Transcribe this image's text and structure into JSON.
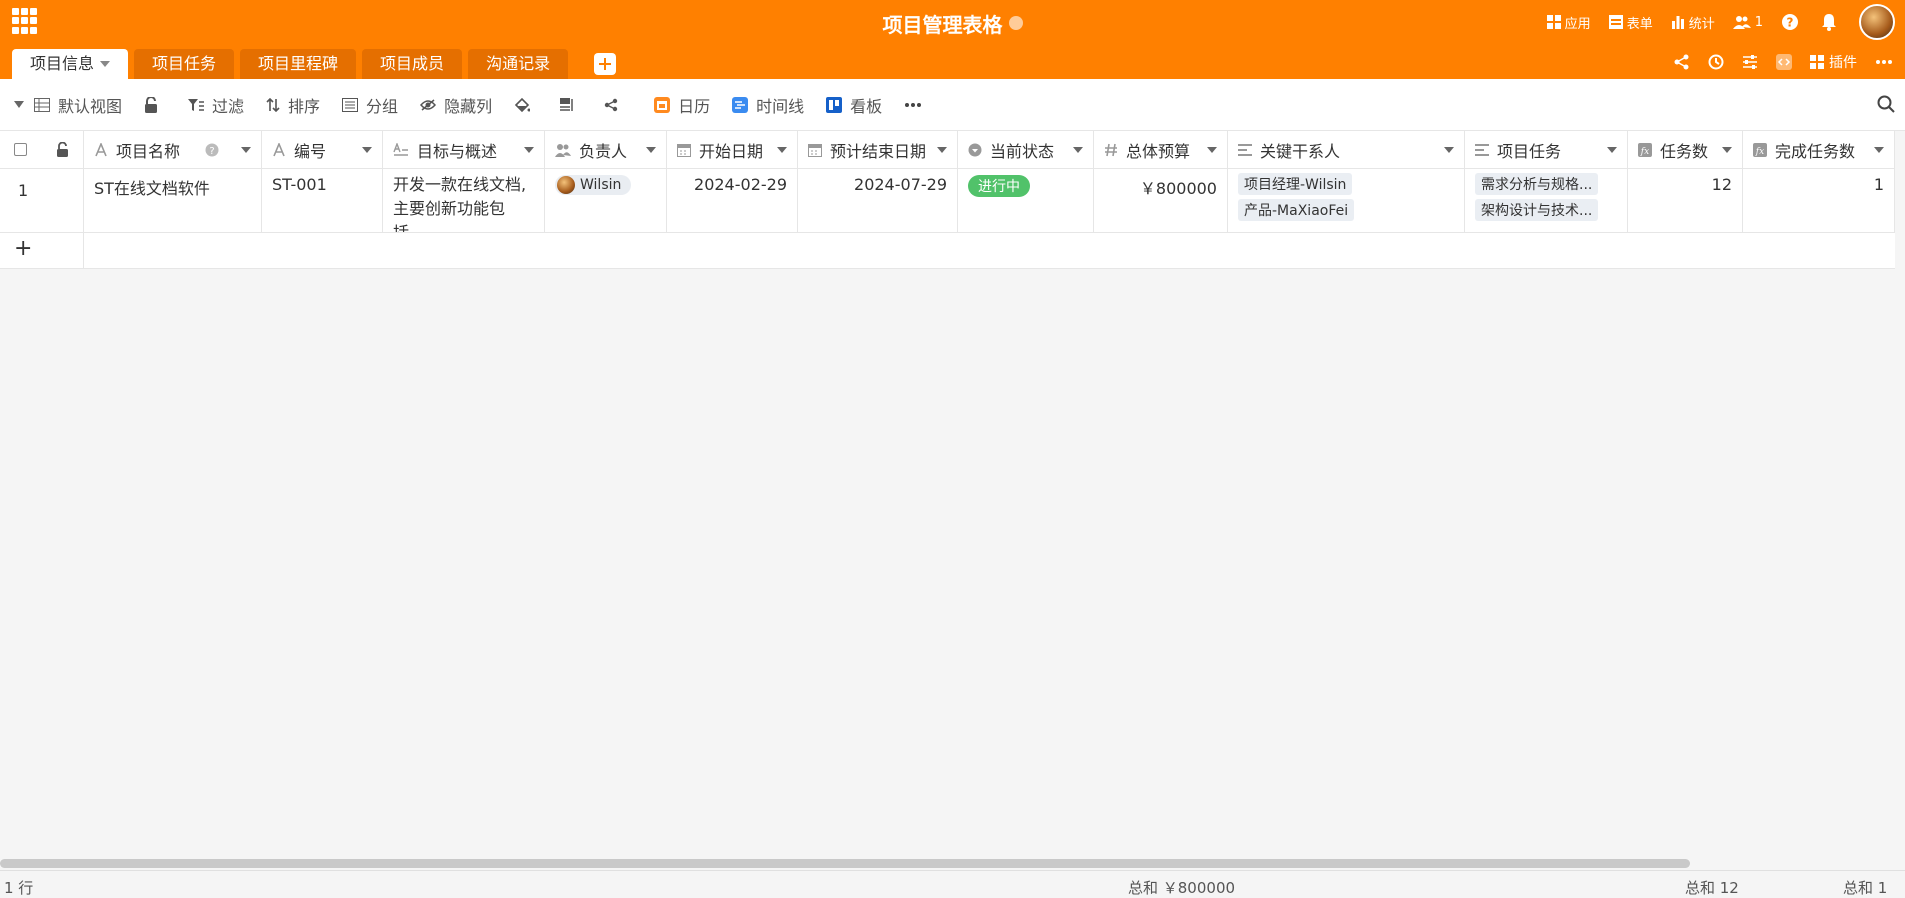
{
  "header": {
    "title": "项目管理表格",
    "right_items": [
      {
        "label": "应用",
        "icon": "apps-icon"
      },
      {
        "label": "表单",
        "icon": "form-icon"
      },
      {
        "label": "统计",
        "icon": "bar-chart-icon"
      },
      {
        "label": "1",
        "icon": "users-icon"
      }
    ]
  },
  "tabs": [
    {
      "label": "项目信息",
      "active": true
    },
    {
      "label": "项目任务"
    },
    {
      "label": "项目里程碑"
    },
    {
      "label": "项目成员"
    },
    {
      "label": "沟通记录"
    }
  ],
  "tabs_right": {
    "plugin_label": "插件"
  },
  "toolbar": {
    "view_label": "默认视图",
    "filter_label": "过滤",
    "sort_label": "排序",
    "group_label": "分组",
    "hide_label": "隐藏列",
    "calendar_label": "日历",
    "timeline_label": "时间线",
    "kanban_label": "看板"
  },
  "columns": [
    {
      "label": "项目名称"
    },
    {
      "label": "编号"
    },
    {
      "label": "目标与概述"
    },
    {
      "label": "负责人"
    },
    {
      "label": "开始日期"
    },
    {
      "label": "预计结束日期"
    },
    {
      "label": "当前状态"
    },
    {
      "label": "总体预算"
    },
    {
      "label": "关键干系人"
    },
    {
      "label": "项目任务"
    },
    {
      "label": "任务数"
    },
    {
      "label": "完成任务数"
    }
  ],
  "rows": [
    {
      "index": "1",
      "name": "ST在线文档软件",
      "code": "ST-001",
      "summary_line1": "开发一款在线文档,",
      "summary_line2": "主要创新功能包括...",
      "owner": "Wilsin",
      "start": "2024-02-29",
      "end": "2024-07-29",
      "status": "进行中",
      "budget": "￥800000",
      "stakeholders": [
        "项目经理-Wilsin",
        "产品-MaXiaoFei"
      ],
      "tasks": [
        "需求分析与规格...",
        "架构设计与技术..."
      ],
      "task_count": "12",
      "done_count": "1"
    }
  ],
  "add_row_symbol": "+",
  "footer": {
    "row_count": "1 行",
    "budget_sum": "总和 ￥800000",
    "task_sum": "总和 12",
    "done_sum": "总和 1"
  },
  "colors": {
    "brand": "#ff8000",
    "status_green": "#51c26a"
  }
}
